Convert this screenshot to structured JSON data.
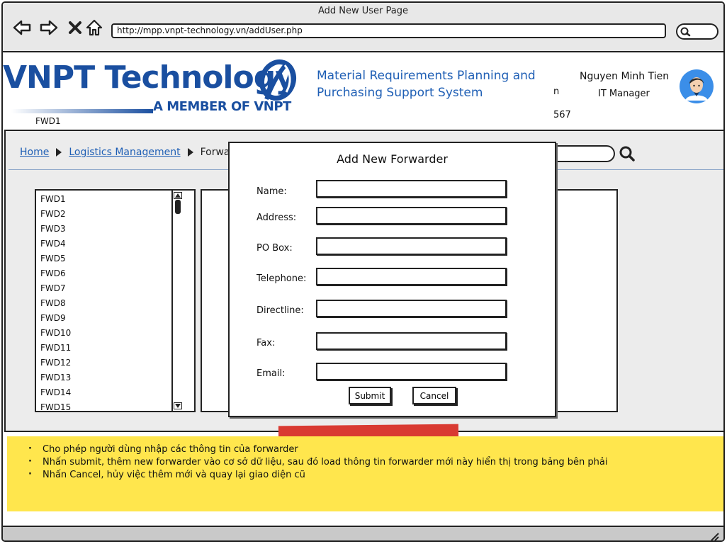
{
  "browser": {
    "window_title": "Add New User Page",
    "url": "http://mpp.vnpt-technology.vn/addUser.php",
    "icons": [
      "back-arrow-icon",
      "forward-arrow-icon",
      "close-x-icon",
      "home-icon",
      "search-icon"
    ]
  },
  "header": {
    "logo_text": "VNPT Technology",
    "logo_subtext": "A MEMBER OF VNPT",
    "selected_label": "FWD1",
    "system_title": "Material Requirements Planning and Purchasing Support System",
    "user_name": "Nguyen Minh Tien",
    "user_role": "IT Manager"
  },
  "breadcrumb": {
    "home": "Home",
    "logistics": "Logistics Management",
    "current": "Forwa"
  },
  "forwarder_list": [
    "FWD1",
    "FWD2",
    "FWD3",
    "FWD4",
    "FWD5",
    "FWD6",
    "FWD7",
    "FWD8",
    "FWD9",
    "FWD10",
    "FWD11",
    "FWD12",
    "FWD13",
    "FWD14",
    "FWD15"
  ],
  "detail_fragments": {
    "line1": "n",
    "line2": "567"
  },
  "modal": {
    "title": "Add New Forwarder",
    "fields": {
      "name": {
        "label": "Name:",
        "value": ""
      },
      "address": {
        "label": "Address:",
        "value": ""
      },
      "po_box": {
        "label": "PO Box:",
        "value": ""
      },
      "telephone": {
        "label": "Telephone:",
        "value": ""
      },
      "directline": {
        "label": "Directline:",
        "value": ""
      },
      "fax": {
        "label": "Fax:",
        "value": ""
      },
      "email": {
        "label": "Email:",
        "value": ""
      }
    },
    "submit_label": "Submit",
    "cancel_label": "Cancel"
  },
  "note": {
    "items": [
      "Cho phép người dùng nhập các thông tin của forwarder",
      "Nhấn submit, thêm new forwarder vào cơ sở dữ liệu, sau đó load thông tin forwarder mới này hiển thị trong bảng bên phải",
      "Nhấn Cancel, hủy việc thêm mới và quay lại giao diện cũ"
    ]
  },
  "colors": {
    "brand_blue": "#1a4fa0",
    "link_blue": "#1f5fb5",
    "note_yellow": "#ffe64d",
    "tape_red": "#d93a32"
  }
}
